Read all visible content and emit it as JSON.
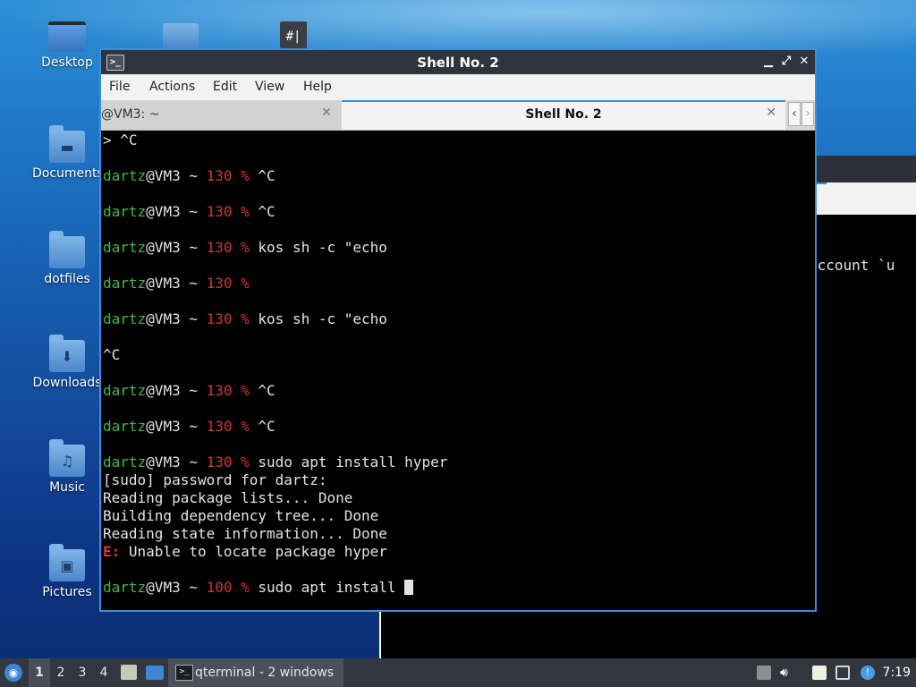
{
  "desktop": {
    "icons": [
      {
        "label": "Desktop"
      },
      {
        "label": "Documents"
      },
      {
        "label": "dotfiles"
      },
      {
        "label": "Downloads"
      },
      {
        "label": "Music"
      },
      {
        "label": "Pictures"
      }
    ]
  },
  "background_window": {
    "visible_text": "account `u"
  },
  "window": {
    "title": "Shell No. 2",
    "menu": [
      "File",
      "Actions",
      "Edit",
      "View",
      "Help"
    ],
    "tabs": [
      {
        "label": "@VM3: ~",
        "active": false
      },
      {
        "label": "Shell No. 2",
        "active": true
      }
    ]
  },
  "terminal": {
    "user": "dartz",
    "host_path": "@VM3 ~ ",
    "lines": {
      "l0": "> ^C",
      "l2_code": "130 %",
      "l2_cmd": " ^C",
      "l4_code": "130 %",
      "l4_cmd": " ^C",
      "l6_code": "130 %",
      "l6_cmd": " kos sh -c \"echo",
      "l8_code": "130 %",
      "l8_cmd": "",
      "l10_code": "130 %",
      "l10_cmd": " kos sh -c \"echo",
      "l12": "^C",
      "l14_code": "130 %",
      "l14_cmd": " ^C",
      "l16_code": "130 %",
      "l16_cmd": " ^C",
      "l18_code": "130 %",
      "l18_cmd": " sudo apt install hyper",
      "l19": "[sudo] password for dartz:",
      "l20": "Reading package lists... Done",
      "l21": "Building dependency tree... Done",
      "l22": "Reading state information... Done",
      "l23_err": "E:",
      "l23_msg": " Unable to locate package hyper",
      "l25_code": "100 %",
      "l25_cmd": " sudo apt install "
    }
  },
  "taskbar": {
    "workspaces": [
      "1",
      "2",
      "3",
      "4"
    ],
    "active_workspace": "1",
    "task_label": "qterminal - 2 windows",
    "clock": "7:19"
  }
}
